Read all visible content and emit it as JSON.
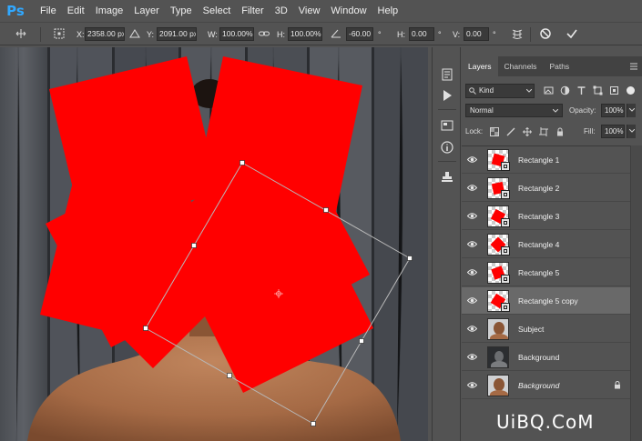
{
  "app": {
    "logo": "Ps",
    "menu": [
      "File",
      "Edit",
      "Image",
      "Layer",
      "Type",
      "Select",
      "Filter",
      "3D",
      "View",
      "Window",
      "Help"
    ]
  },
  "options_bar": {
    "x_label": "X:",
    "x_value": "2358.00 px",
    "y_label": "Y:",
    "y_value": "2091.00 px",
    "w_label": "W:",
    "w_value": "100.00%",
    "h_label": "H:",
    "h_value": "100.00%",
    "angle_value": "-60.00",
    "angle_unit": "°",
    "hskew_label": "H:",
    "hskew_value": "0.00",
    "vskew_label": "V:",
    "vskew_value": "0.00",
    "icons": [
      "reference-point-icon",
      "delta-icon",
      "link-icon",
      "angle-icon",
      "warp-icon",
      "cancel-icon",
      "commit-icon"
    ]
  },
  "panel": {
    "tabs": [
      {
        "label": "Layers",
        "active": true
      },
      {
        "label": "Channels",
        "active": false
      },
      {
        "label": "Paths",
        "active": false
      }
    ],
    "kind_label": "Kind",
    "blend_mode": "Normal",
    "opacity_label": "Opacity:",
    "opacity_value": "100%",
    "lock_label": "Lock:",
    "fill_label": "Fill:",
    "fill_value": "100%"
  },
  "layers": [
    {
      "name": "Rectangle 1",
      "thumb": "rect",
      "italic": false,
      "selected": false,
      "locked": false
    },
    {
      "name": "Rectangle 2",
      "thumb": "rect",
      "italic": false,
      "selected": false,
      "locked": false
    },
    {
      "name": "Rectangle 3",
      "thumb": "rect",
      "italic": false,
      "selected": false,
      "locked": false
    },
    {
      "name": "Rectangle 4",
      "thumb": "rect",
      "italic": false,
      "selected": false,
      "locked": false
    },
    {
      "name": "Rectangle 5",
      "thumb": "rect",
      "italic": false,
      "selected": false,
      "locked": false
    },
    {
      "name": "Rectangle 5 copy",
      "thumb": "rect",
      "italic": false,
      "selected": true,
      "locked": false
    },
    {
      "name": "Subject",
      "thumb": "photo",
      "italic": false,
      "selected": false,
      "locked": false
    },
    {
      "name": "Background",
      "thumb": "dark",
      "italic": false,
      "selected": false,
      "locked": false
    },
    {
      "name": "Background",
      "thumb": "photo",
      "italic": true,
      "selected": false,
      "locked": true
    }
  ],
  "watermark": "UiBQ.CoM",
  "colors": {
    "rect_fill": "#ff0000",
    "ui_bg": "#535353",
    "accent": "#31a8ff"
  }
}
